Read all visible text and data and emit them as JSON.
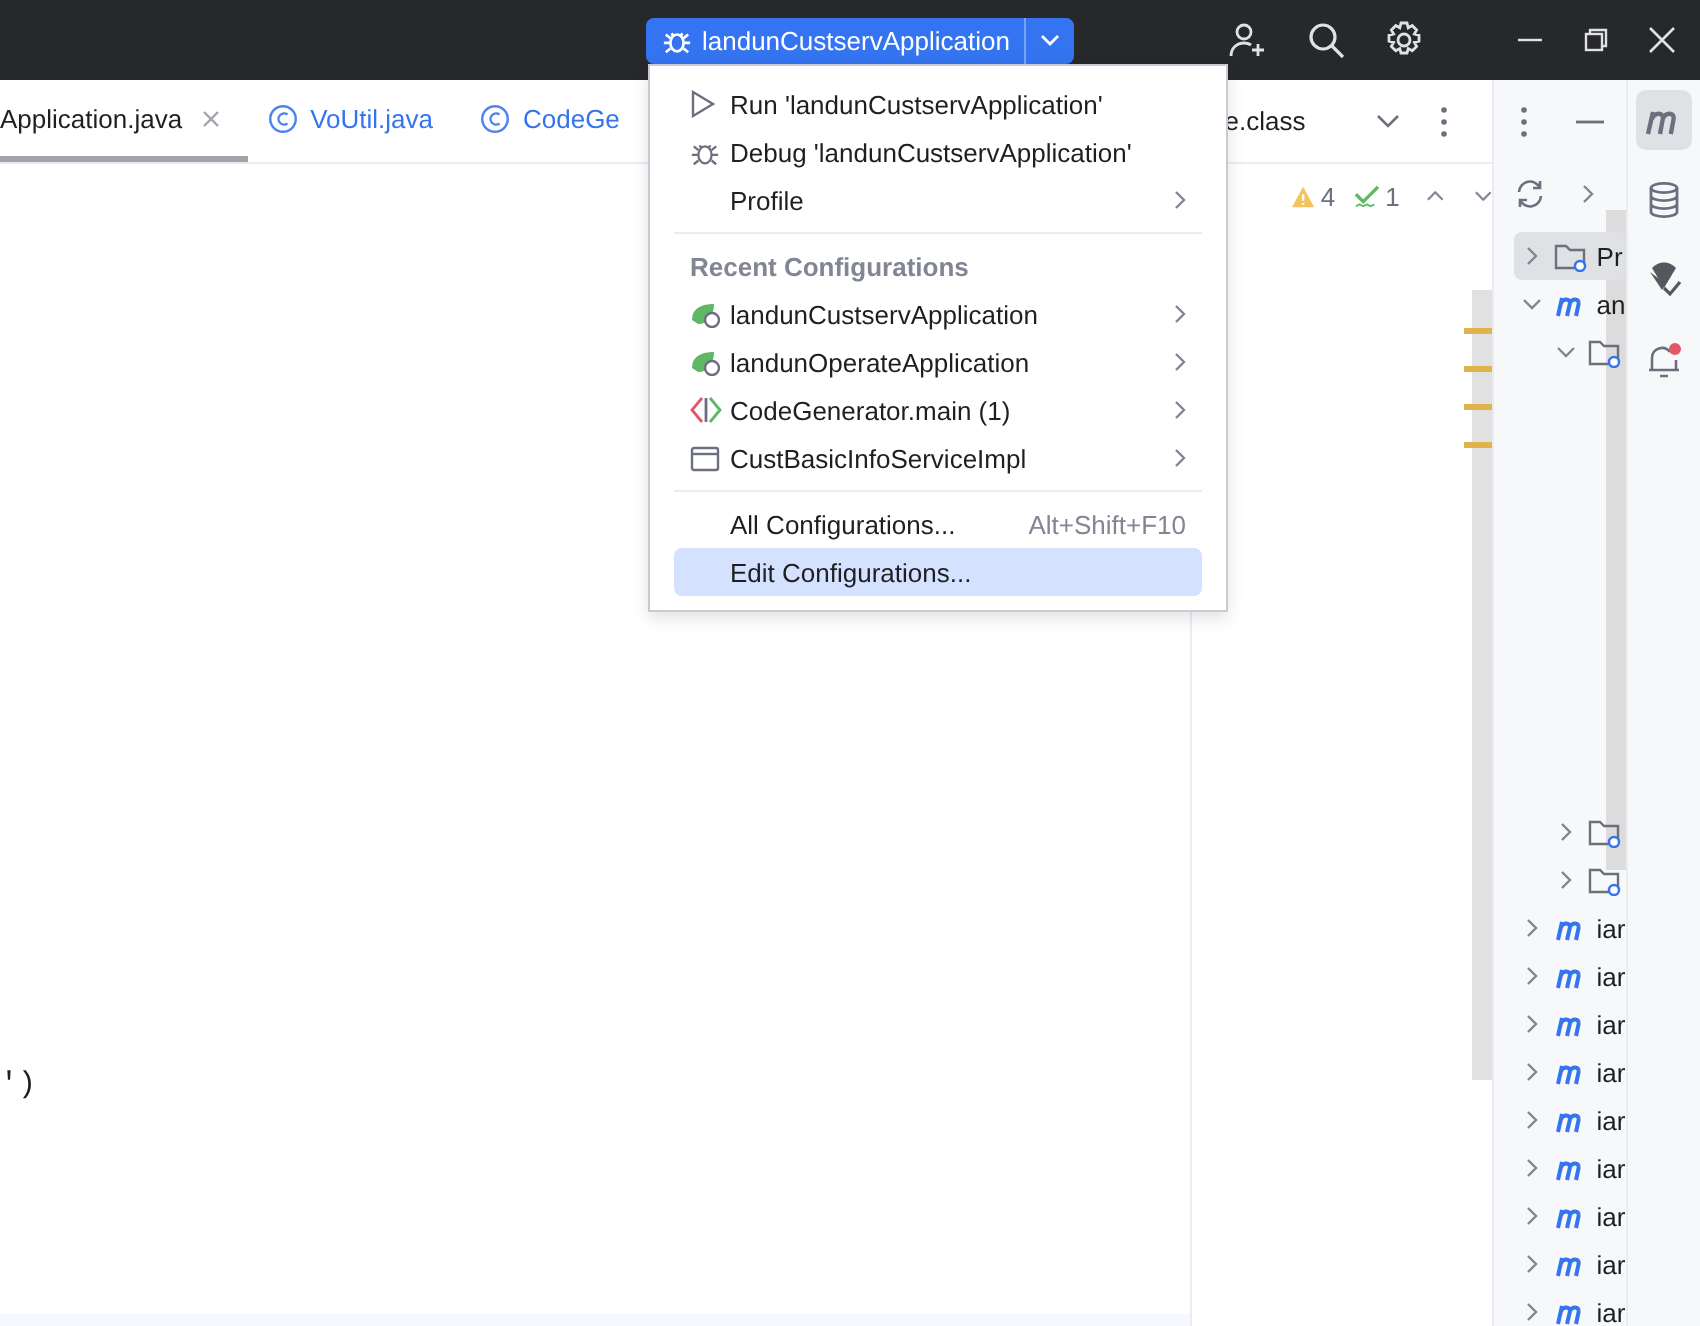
{
  "run_widget": {
    "label": "landunCustservApplication"
  },
  "editor": {
    "tabs": [
      {
        "label": "Application.java",
        "selected": true,
        "closable": true,
        "kind": "plain"
      },
      {
        "label": "VoUtil.java",
        "selected": false,
        "closable": false,
        "kind": "class"
      },
      {
        "label": "CodeGe",
        "selected": false,
        "closable": false,
        "kind": "class"
      }
    ],
    "code_text": "')"
  },
  "split_editor": {
    "tab": "e.class",
    "warnings": "4",
    "weak_warnings": "1"
  },
  "run_menu": {
    "items": [
      {
        "kind": "run",
        "label": "Run 'landunCustservApplication'",
        "submenu": false,
        "selected": false
      },
      {
        "kind": "debug",
        "label": "Debug 'landunCustservApplication'",
        "submenu": false,
        "selected": false
      },
      {
        "kind": "plain",
        "label": "Profile",
        "submenu": true,
        "selected": false
      },
      {
        "kind": "separator"
      },
      {
        "kind": "header",
        "label": "Recent Configurations"
      },
      {
        "kind": "app",
        "label": "landunCustservApplication",
        "submenu": true,
        "selected": false
      },
      {
        "kind": "app",
        "label": "landunOperateApplication",
        "submenu": true,
        "selected": false
      },
      {
        "kind": "main",
        "label": "CodeGenerator.main (1)",
        "submenu": true,
        "selected": false
      },
      {
        "kind": "class",
        "label": "CustBasicInfoServiceImpl",
        "submenu": true,
        "selected": false
      },
      {
        "kind": "separator"
      },
      {
        "kind": "plain",
        "label": "All Configurations...",
        "shortcut": "Alt+Shift+F10",
        "submenu": false,
        "selected": false
      },
      {
        "kind": "plain",
        "label": "Edit Configurations...",
        "submenu": false,
        "selected": true
      }
    ]
  },
  "project_tree": [
    {
      "kind": "folder",
      "label": "Pr",
      "expanded": false,
      "selected": true
    },
    {
      "kind": "module",
      "label": "an",
      "expanded": true,
      "selected": false,
      "children": [
        {
          "kind": "folder",
          "expanded": true,
          "selected": false
        },
        {
          "kind": "folder",
          "expanded": false,
          "selected": false
        },
        {
          "kind": "folder",
          "expanded": false,
          "selected": false
        }
      ]
    },
    {
      "kind": "module",
      "label": "iar",
      "expanded": false,
      "selected": false
    },
    {
      "kind": "module",
      "label": "iar",
      "expanded": false,
      "selected": false
    },
    {
      "kind": "module",
      "label": "iar",
      "expanded": false,
      "selected": false
    },
    {
      "kind": "module",
      "label": "iar",
      "expanded": false,
      "selected": false
    },
    {
      "kind": "module",
      "label": "iar",
      "expanded": false,
      "selected": false
    },
    {
      "kind": "module",
      "label": "iar",
      "expanded": false,
      "selected": false
    },
    {
      "kind": "module",
      "label": "iar",
      "expanded": false,
      "selected": false
    },
    {
      "kind": "module",
      "label": "iar",
      "expanded": false,
      "selected": false
    },
    {
      "kind": "module",
      "label": "iar",
      "expanded": false,
      "selected": false
    }
  ],
  "tool_strip": [
    {
      "kind": "maven",
      "selected": true
    },
    {
      "kind": "database",
      "selected": false
    },
    {
      "kind": "coverage",
      "selected": false
    },
    {
      "kind": "notifications",
      "selected": false
    }
  ]
}
